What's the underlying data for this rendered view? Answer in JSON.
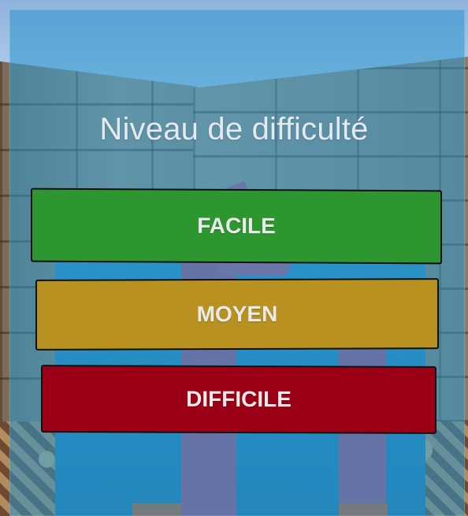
{
  "menu": {
    "title": "Niveau de difficulté",
    "buttons": {
      "easy": "FACILE",
      "medium": "MOYEN",
      "hard": "DIFFICILE"
    }
  },
  "colors": {
    "easy": "#2e9630",
    "medium": "#b89121",
    "hard": "#9b0016",
    "panel": "#2896cd"
  }
}
